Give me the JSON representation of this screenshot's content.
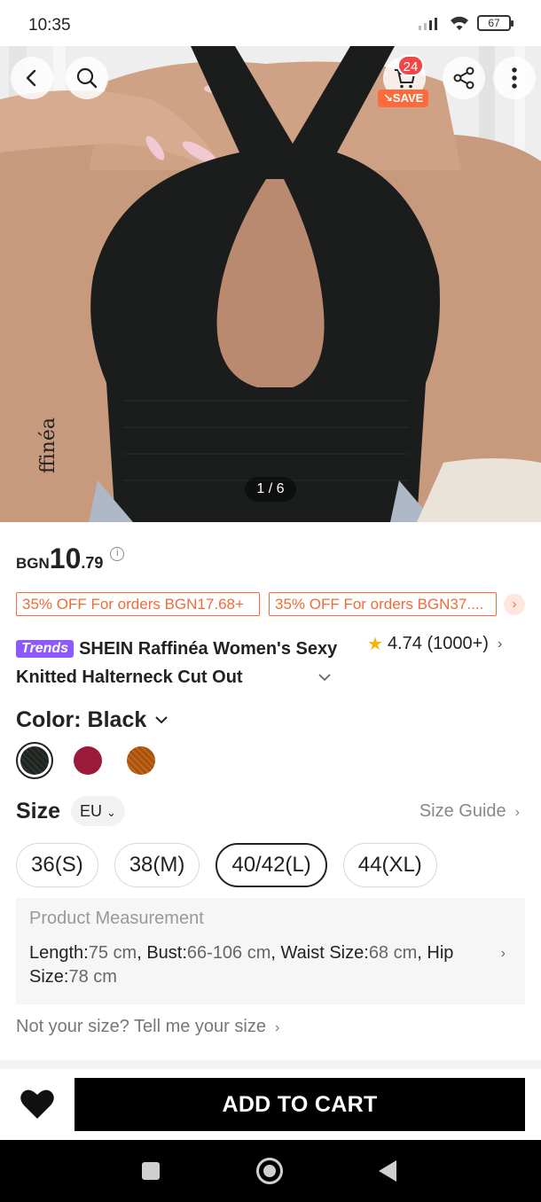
{
  "status_bar": {
    "time": "10:35",
    "battery": "67"
  },
  "gallery": {
    "page_indicator": "1 / 6",
    "cart_count": "24",
    "save_label": "SAVE",
    "watermark": "ffinéa"
  },
  "price": {
    "currency": "BGN",
    "integer": "10",
    "decimal": ".79"
  },
  "coupons": [
    "35% OFF For orders BGN17.68+",
    "35% OFF For orders BGN37...."
  ],
  "product": {
    "badge": "Trends",
    "title": "SHEIN Raffinéa Women's Sexy Knitted Halterneck Cut Out",
    "rating": "4.74",
    "review_count": "(1000+)"
  },
  "color": {
    "label": "Color: Black",
    "swatches": [
      {
        "name": "Black",
        "hex": "#1f2420",
        "selected": true
      },
      {
        "name": "Burgundy",
        "hex": "#9a1a3a",
        "selected": false
      },
      {
        "name": "Brown",
        "hex": "#a8520f",
        "selected": false
      }
    ]
  },
  "size": {
    "label": "Size",
    "region": "EU",
    "guide_label": "Size Guide",
    "options": [
      "36(S)",
      "38(M)",
      "40/42(L)",
      "44(XL)"
    ],
    "selected": "40/42(L)"
  },
  "measurement": {
    "title": "Product Measurement",
    "length_label": "Length:",
    "length_value": "75 cm",
    "bust_label": "Bust:",
    "bust_value": "66-106 cm",
    "waist_label": "Waist Size:",
    "waist_value": "68 cm",
    "hip_label": "Hip Size:",
    "hip_value": "78 cm"
  },
  "not_your_size": "Not your size? Tell me your size",
  "actions": {
    "add_to_cart": "ADD TO CART"
  }
}
